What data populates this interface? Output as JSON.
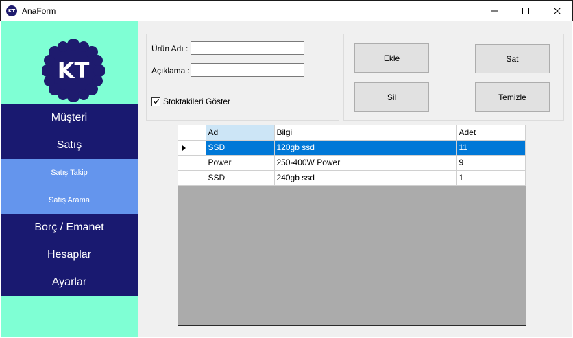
{
  "window": {
    "title": "AnaForm",
    "icon_text": "KT",
    "controls": [
      "minimize-icon",
      "maximize-icon",
      "close-icon"
    ]
  },
  "colors": {
    "sidebar_bg": "#7fffd4",
    "menu_bg": "#191970",
    "submenu_bg": "#6495ed",
    "selection": "#0078d7",
    "grid_bg": "#ababab"
  },
  "sidebar": {
    "logo_text": "KT",
    "menu": [
      {
        "label": "Müşteri"
      },
      {
        "label": "Satış"
      }
    ],
    "submenu": [
      {
        "label": "Satış Takip"
      },
      {
        "label": "Satış Arama"
      }
    ],
    "menu_bottom": [
      {
        "label": "Borç / Emanet"
      },
      {
        "label": "Hesaplar"
      },
      {
        "label": "Ayarlar"
      }
    ]
  },
  "form": {
    "product_name_label": "Ürün Adı :",
    "product_name_value": "",
    "description_label": "Açıklama :",
    "description_value": "",
    "show_in_stock_label": "Stoktakileri Göster",
    "show_in_stock_checked": true
  },
  "buttons": {
    "add": "Ekle",
    "sell": "Sat",
    "delete": "Sil",
    "clear": "Temizle"
  },
  "grid": {
    "columns": [
      "Ad",
      "Bilgi",
      "Adet"
    ],
    "rows": [
      {
        "ad": "SSD",
        "bilgi": "120gb ssd",
        "adet": "11",
        "selected": true
      },
      {
        "ad": "Power",
        "bilgi": "250-400W Power",
        "adet": "9",
        "selected": false
      },
      {
        "ad": "SSD",
        "bilgi": "240gb ssd",
        "adet": "1",
        "selected": false
      }
    ]
  }
}
